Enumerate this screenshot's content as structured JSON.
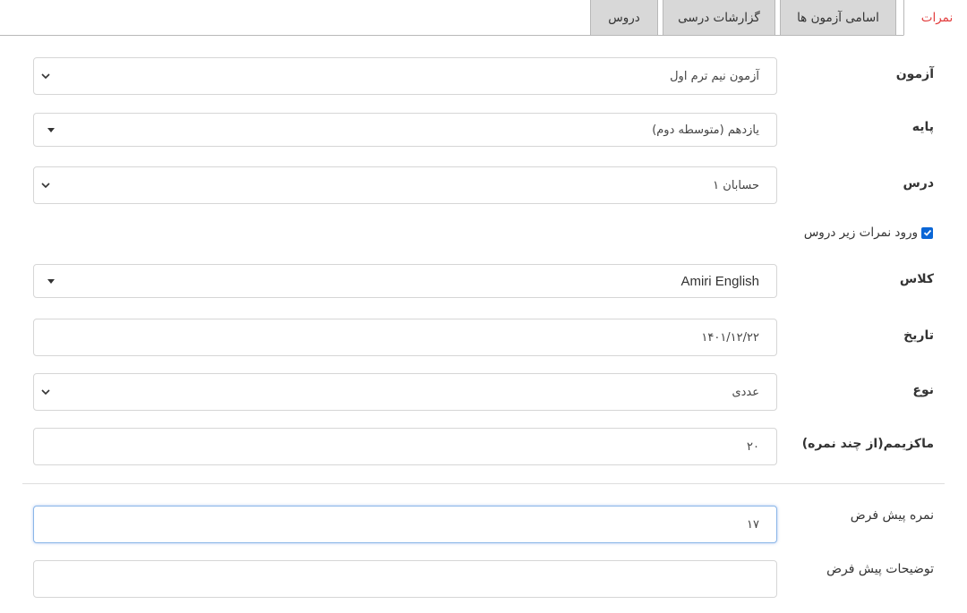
{
  "tabs": [
    {
      "label": "نمرات",
      "active": true
    },
    {
      "label": "اسامی آزمون ها",
      "active": false
    },
    {
      "label": "گزارشات درسی",
      "active": false
    },
    {
      "label": "دروس",
      "active": false
    }
  ],
  "form": {
    "exam": {
      "label": "آزمون",
      "value": "آزمون نیم ترم اول"
    },
    "grade": {
      "label": "پایه",
      "value": "یازدهم (متوسطه دوم)"
    },
    "course": {
      "label": "درس",
      "value": "حسابان ۱"
    },
    "subcourse_checkbox": {
      "label": "ورود نمرات زیر دروس",
      "checked": true
    },
    "class": {
      "label": "کلاس",
      "value": "Amiri English"
    },
    "date": {
      "label": "تاریخ",
      "value": "۱۴۰۱/۱۲/۲۲"
    },
    "type": {
      "label": "نوع",
      "value": "عددی"
    },
    "max_score": {
      "label": "ماکزیمم(از چند نمره)",
      "value": "۲۰"
    },
    "default_score": {
      "label": "نمره پیش فرض",
      "value": "۱۷"
    },
    "default_description": {
      "label": "توضیحات پیش فرض",
      "value": ""
    }
  },
  "colors": {
    "active_tab_text": "#e23b3b",
    "checkbox": "#0a66d6",
    "focus_border": "#8ab6e8"
  }
}
